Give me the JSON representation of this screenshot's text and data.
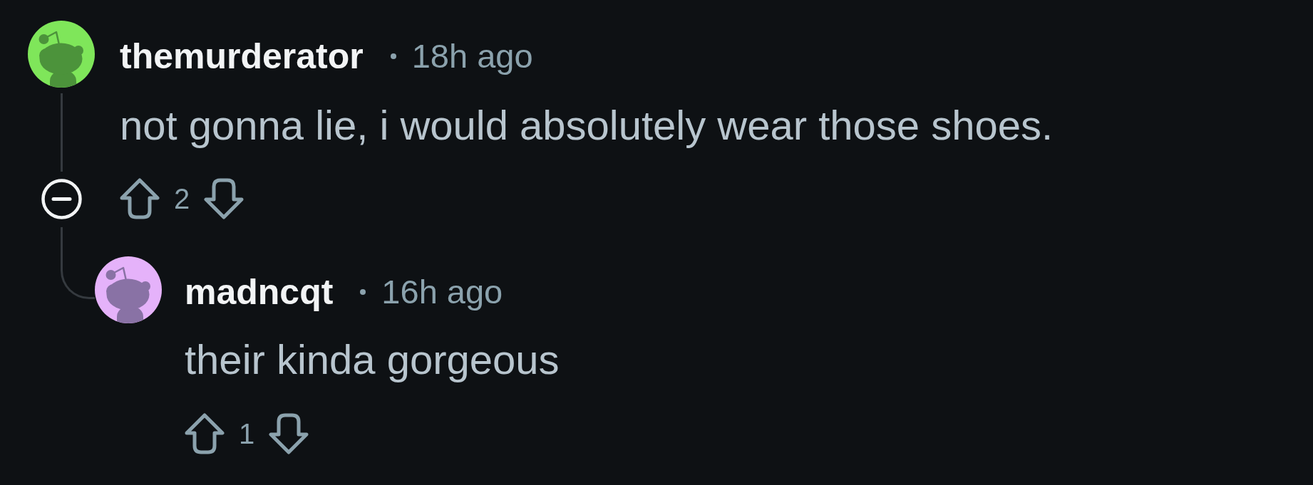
{
  "comments": [
    {
      "username": "themurderator",
      "time": "18h ago",
      "color": "#7fe65a",
      "text": "not gonna lie, i would absolutely wear those shoes.",
      "votes": "2",
      "replies": [
        {
          "username": "madncqt",
          "time": "16h ago",
          "color": "#e5b2fa",
          "text": "their kinda gorgeous",
          "votes": "1"
        }
      ]
    }
  ]
}
